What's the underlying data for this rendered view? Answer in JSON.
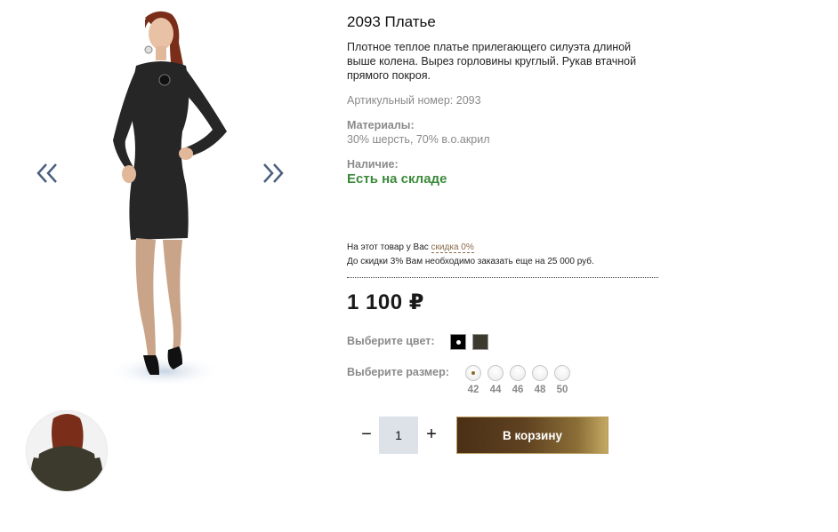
{
  "product": {
    "title": "2093 Платье",
    "description": "Плотное теплое платье прилегающего силуэта длиной выше колена. Вырез горловины круглый. Рукав втачной прямого покроя.",
    "sku": "Артикульный номер: 2093",
    "materials_label": "Материалы:",
    "materials_value": "30% шерсть, 70% в.о.акрил",
    "availability_label": "Наличие:",
    "availability_value": "Есть на складе",
    "availability_color": "#3c8a3c"
  },
  "discount": {
    "line1_prefix": "На этот товар у Вас",
    "line1_link": "скидка 0%",
    "line2": "До скидки 3% Вам необходимо заказать еще на 25 000 руб."
  },
  "price": "1 100 ₽",
  "color_selector": {
    "label": "Выберите цвет:",
    "options": [
      {
        "name": "black-swatch",
        "color": "#000000",
        "selected": true
      },
      {
        "name": "olive-swatch",
        "color": "#3b3a2c",
        "selected": false
      }
    ]
  },
  "size_selector": {
    "label": "Выберите размер:",
    "options": [
      "42",
      "44",
      "46",
      "48",
      "50"
    ],
    "selected": "42"
  },
  "cart": {
    "quantity": "1",
    "minus": "−",
    "plus": "+",
    "button_label": "В корзину",
    "button_gradient": [
      "#4a2f16",
      "#c4a964"
    ]
  },
  "gallery": {
    "prev_icon": "chevron-double-left-icon",
    "next_icon": "chevron-double-right-icon",
    "arrow_color": "#4a6080"
  }
}
